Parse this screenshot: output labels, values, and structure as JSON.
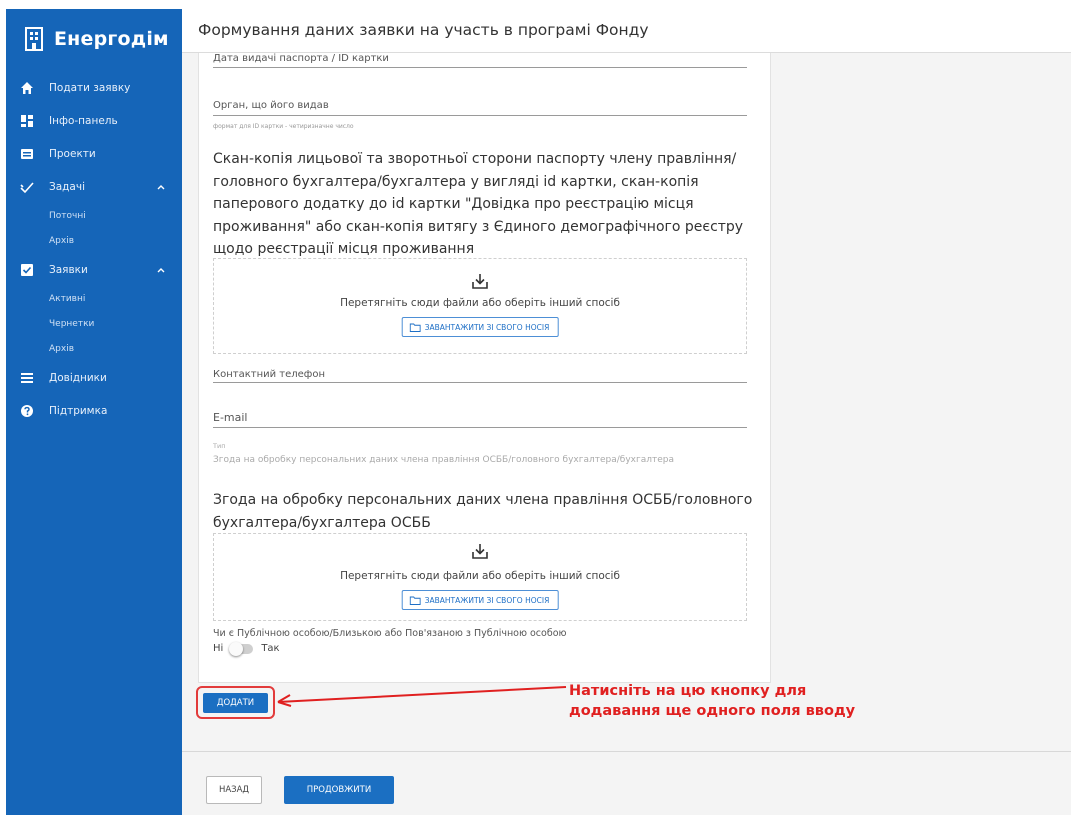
{
  "app": {
    "name": "Енергодім",
    "page_title": "Формування даних заявки на участь в програмі Фонду"
  },
  "sidebar": {
    "items": [
      {
        "label": "Подати заявку",
        "icon": "home-icon"
      },
      {
        "label": "Інфо-панель",
        "icon": "dashboard-icon"
      },
      {
        "label": "Проекти",
        "icon": "briefcase-icon"
      },
      {
        "label": "Задачі",
        "icon": "check-icon",
        "expanded": true,
        "subitems": [
          "Поточні",
          "Архів"
        ]
      },
      {
        "label": "Заявки",
        "icon": "checkbox-icon",
        "expanded": true,
        "subitems": [
          "Активні",
          "Чернетки",
          "Архів"
        ]
      },
      {
        "label": "Довідники",
        "icon": "list-icon"
      },
      {
        "label": "Підтримка",
        "icon": "help-icon"
      }
    ]
  },
  "form": {
    "passport_date_label": "Дата видачі паспорта / ID картки",
    "issuer_label": "Орган, що його видав",
    "issuer_helper": "формат для ID картки - четиризначне число",
    "scan_label": "Скан-копія лицьової та зворотньої сторони паспорту члену правління/головного бухгалтера/бухгалтера у вигляді id картки, скан-копія паперового додатку до id картки \"Довідка про реєстрацію місця проживання\" або скан-копія витягу з Єдиного демографічного реєстру щодо реєстрації місця проживання",
    "drop_hint": "Перетягніть сюди файли або оберіть інший спосіб",
    "upload_label": "ЗАВАНТАЖИТИ ЗІ СВОГО НОСІЯ",
    "phone_label": "Контактний телефон",
    "email_label": "E-mail",
    "consent_small_label": "Тип",
    "consent_field_value": "Згода на обробку персональних даних члена правління ОСББ/головного бухгалтера/бухгалтера",
    "consent_label": "Згода на обробку персональних даних члена правління ОСББ/головного бухгалтера/бухгалтера ОСББ",
    "pep_label": "Чи є Публічною особою/Близькою або Пов'язаною з Публічною особою",
    "pep_no": "Ні",
    "pep_yes": "Так",
    "add_button": "ДОДАТИ"
  },
  "annotation": {
    "text": "Натисніть на цю кнопку для додавання ще одного поля вводу",
    "color": "#e02020"
  },
  "footer": {
    "back_button": "НАЗАД",
    "next_button": "ПРОДОВЖИТИ"
  },
  "colors": {
    "sidebar": "#1565b8",
    "primary": "#1b6fc2",
    "highlight": "#e23b3b"
  }
}
